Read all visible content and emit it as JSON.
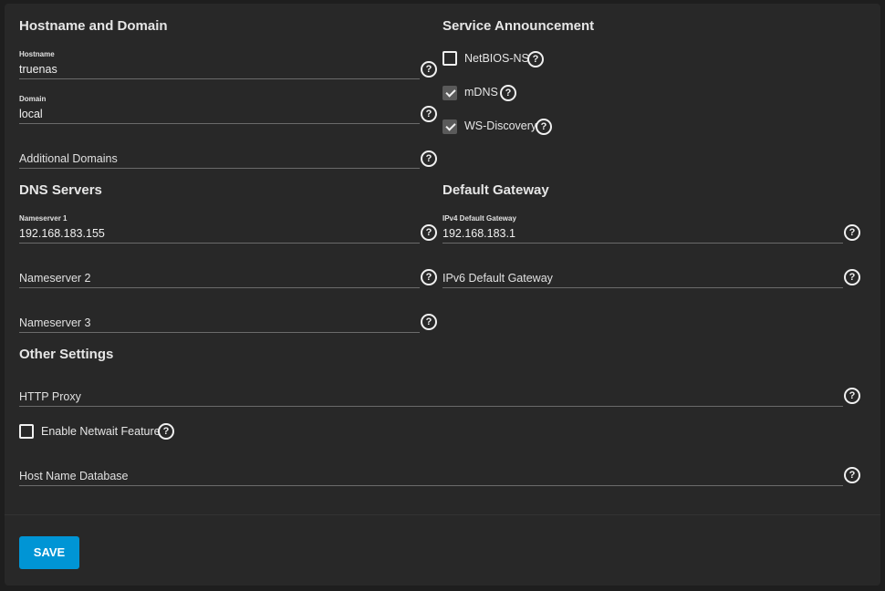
{
  "hostname_domain": {
    "title": "Hostname and Domain",
    "hostname": {
      "label": "Hostname",
      "value": "truenas"
    },
    "domain": {
      "label": "Domain",
      "value": "local"
    },
    "additional_domains": {
      "placeholder": "Additional Domains"
    }
  },
  "service_announcement": {
    "title": "Service Announcement",
    "items": [
      {
        "label": "NetBIOS-NS",
        "checked": false
      },
      {
        "label": "mDNS",
        "checked": true
      },
      {
        "label": "WS-Discovery",
        "checked": true
      }
    ]
  },
  "dns_servers": {
    "title": "DNS Servers",
    "nameserver1": {
      "label": "Nameserver 1",
      "value": "192.168.183.155"
    },
    "nameserver2": {
      "placeholder": "Nameserver 2"
    },
    "nameserver3": {
      "placeholder": "Nameserver 3"
    }
  },
  "default_gateway": {
    "title": "Default Gateway",
    "ipv4": {
      "label": "IPv4 Default Gateway",
      "value": "192.168.183.1"
    },
    "ipv6": {
      "placeholder": "IPv6 Default Gateway"
    }
  },
  "other_settings": {
    "title": "Other Settings",
    "http_proxy": {
      "placeholder": "HTTP Proxy"
    },
    "netwait": {
      "label": "Enable Netwait Feature",
      "checked": false
    },
    "host_name_database": {
      "placeholder": "Host Name Database"
    }
  },
  "help_glyph": "?",
  "actions": {
    "save_label": "SAVE"
  },
  "colors": {
    "accent": "#0095d5",
    "card_bg": "#282828",
    "page_bg": "#1e1e1e"
  }
}
